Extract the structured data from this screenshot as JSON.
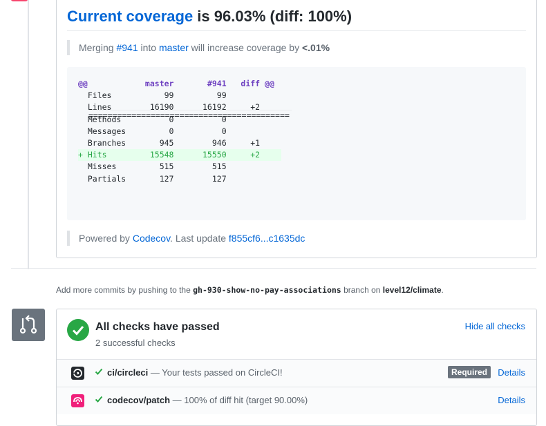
{
  "coverage": {
    "title_link": "Current coverage",
    "title_rest": " is 96.03% (diff: 100%)",
    "merge_prefix": "Merging ",
    "merge_pr": "#941",
    "merge_into": " into ",
    "merge_branch": "master",
    "merge_suffix": " will increase coverage by ",
    "merge_delta": "<.01%",
    "diff_lines": [
      {
        "type": "header",
        "text": "@@            master       #941   diff @@"
      },
      {
        "type": "rule",
        "text": "=========================================="
      },
      {
        "type": "normal",
        "text": "  Files           99         99          "
      },
      {
        "type": "normal",
        "text": "  Lines        16190      16192     +2    "
      },
      {
        "type": "normal",
        "text": "  Methods          0          0          "
      },
      {
        "type": "normal",
        "text": "  Messages         0          0          "
      },
      {
        "type": "normal",
        "text": "  Branches       945        946     +1    "
      },
      {
        "type": "rule",
        "text": "=========================================="
      },
      {
        "type": "added",
        "text": "+ Hits         15548      15550     +2    "
      },
      {
        "type": "normal",
        "text": "  Misses         515        515          "
      },
      {
        "type": "normal",
        "text": "  Partials       127        127          "
      }
    ],
    "powered_prefix": "Powered by ",
    "powered_link": "Codecov",
    "powered_mid": ". Last update ",
    "powered_commits": "f855cf6...c1635dc"
  },
  "push_hint": {
    "prefix": "Add more commits by pushing to the ",
    "branch": "gh-930-show-no-pay-associations",
    "mid": " branch on ",
    "repo": "level12/climate",
    "suffix": "."
  },
  "checks": {
    "title": "All checks have passed",
    "subtitle": "2 successful checks",
    "hide_label": "Hide all checks",
    "items": [
      {
        "name": "ci/circleci",
        "desc": " — Your tests passed on CircleCI!",
        "required": "Required",
        "details": "Details",
        "icon": "circleci-icon",
        "icon_color": "#24292e"
      },
      {
        "name": "codecov/patch",
        "desc": " — 100% of diff hit (target 90.00%)",
        "required": "",
        "details": "Details",
        "icon": "codecov-icon",
        "icon_color": "#f01f7a"
      }
    ]
  },
  "colors": {
    "success": "#28a745",
    "link": "#0366d6",
    "accent_pink": "#f7466e"
  }
}
